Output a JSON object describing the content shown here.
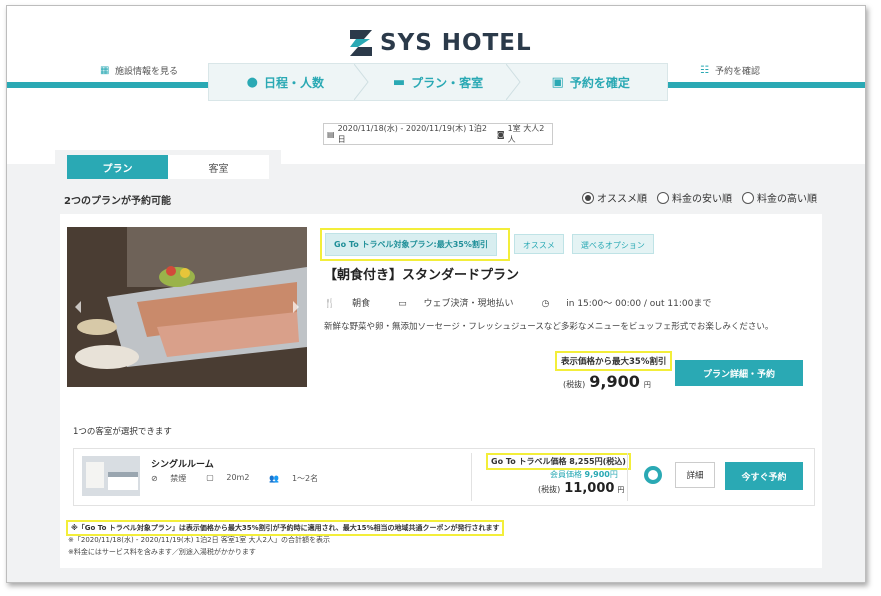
{
  "brand": {
    "name": "SYS HOTEL"
  },
  "top_links": {
    "facility": "施設情報を見る",
    "confirm": "予約を確認"
  },
  "steps": [
    {
      "label": "日程・人数"
    },
    {
      "label": "プラン・客室"
    },
    {
      "label": "予約を確定"
    }
  ],
  "search": {
    "dates": "2020/11/18(水) - 2020/11/19(木) 1泊2日",
    "guests": "1室 大人2人"
  },
  "tabs": [
    {
      "label": "プラン"
    },
    {
      "label": "客室"
    }
  ],
  "availability": "2つのプランが予約可能",
  "sort_options": [
    {
      "label": "オススメ順",
      "selected": true
    },
    {
      "label": "料金の安い順",
      "selected": false
    },
    {
      "label": "料金の高い順",
      "selected": false
    }
  ],
  "plan": {
    "badges": [
      "Go To トラベル対象プラン:最大35%割引",
      "オススメ",
      "選べるオプション"
    ],
    "title": "【朝食付き】スタンダードプラン",
    "meal": "朝食",
    "payment": "ウェブ決済・現地払い",
    "checkin": "in 15:00～ 00:00 / out 11:00まで",
    "description": "新鮮な野菜や卵・無添加ソーセージ・フレッシュジュースなど多彩なメニューをビュッフェ形式でお楽しみください。",
    "discount_note": "表示価格から最大35%割引",
    "tax_label": "(税抜)",
    "price": "9,900",
    "yen": "円",
    "detail_button": "プラン詳細・予約"
  },
  "rooms_available": "1つの客室が選択できます",
  "room": {
    "name": "シングルルーム",
    "smoking": "禁煙",
    "size": "20m2",
    "capacity": "1〜2名",
    "goto_price": "Go To トラベル価格 8,255円(税込)",
    "member_label": "会員価格",
    "member_price": "9,900",
    "tax_label": "(税抜)",
    "price": "11,000",
    "yen": "円",
    "detail_button": "詳細",
    "book_button": "今すぐ予約"
  },
  "notes": {
    "goto_note": "※「Go To トラベル対象プラン」は表示価格から最大35%割引が予約時に適用され、最大15%相当の地域共通クーポンが発行されます",
    "total_note": "※「2020/11/18(水) - 2020/11/19(木) 1泊2日 客室1室 大人2人」の合計額を表示",
    "tax_note": "※料金にはサービス料を含みます／別途入湯税がかかります"
  },
  "colors": {
    "accent": "#2aa9b4",
    "highlight": "#f3ee3a"
  }
}
